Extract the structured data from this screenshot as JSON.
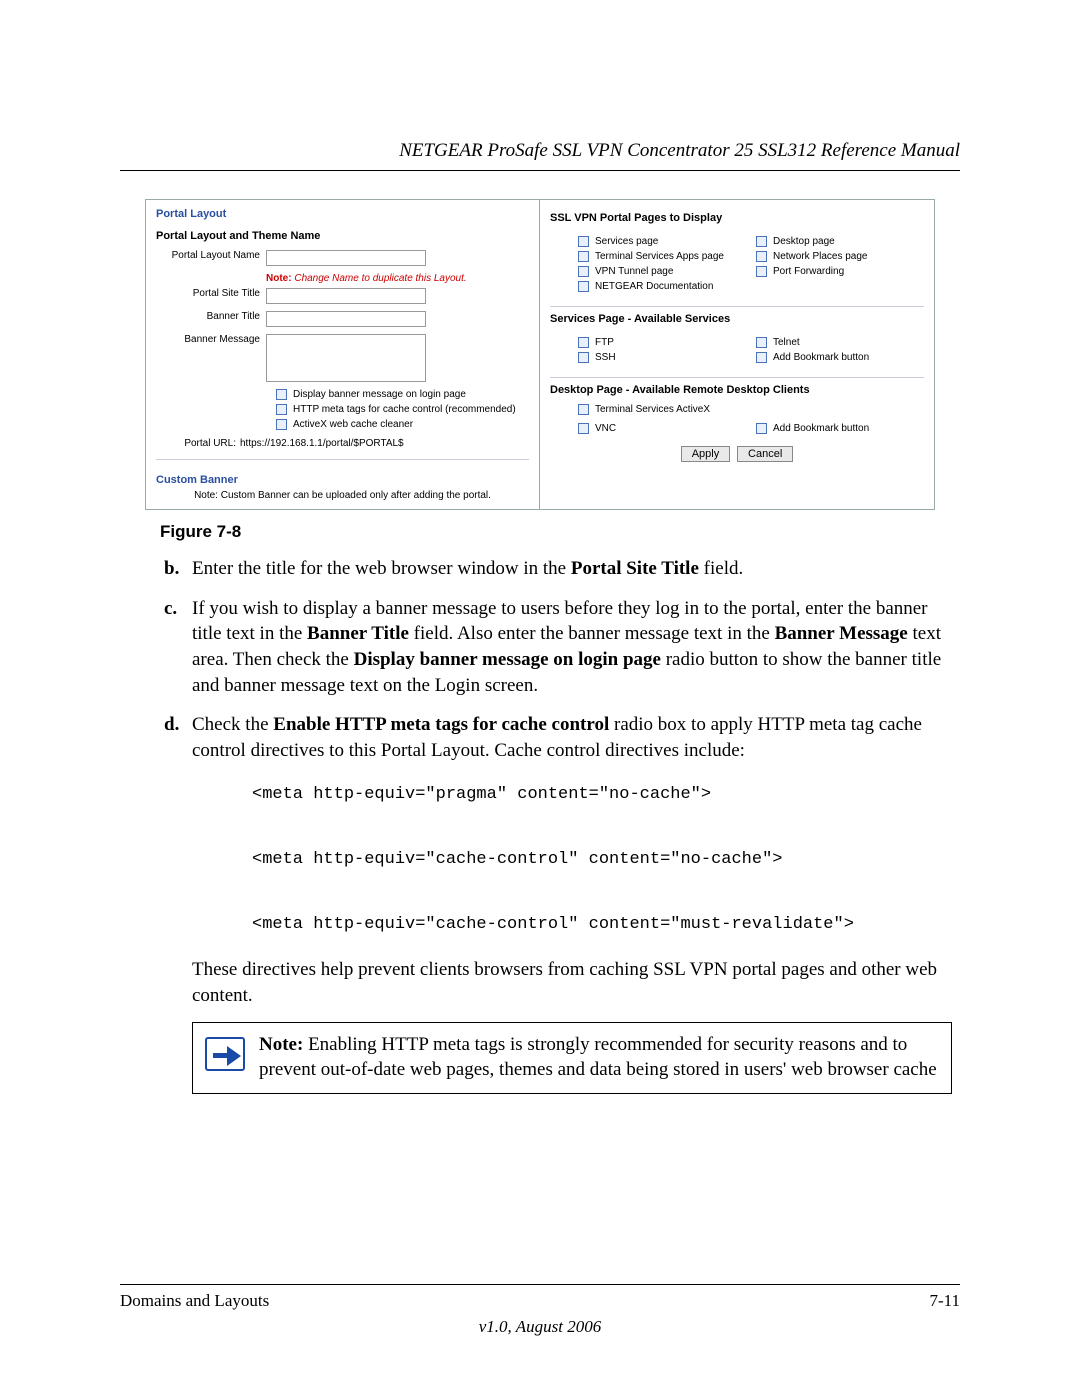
{
  "header": {
    "title": "NETGEAR ProSafe SSL VPN Concentrator 25 SSL312 Reference Manual"
  },
  "figure": {
    "caption": "Figure 7-8",
    "left": {
      "panel_title": "Portal Layout",
      "section_title": "Portal Layout and Theme Name",
      "labels": {
        "layout_name": "Portal Layout Name",
        "site_title": "Portal Site Title",
        "banner_title": "Banner Title",
        "banner_message": "Banner Message"
      },
      "note_prefix": "Note:",
      "note_text": " Change Name to duplicate this Layout.",
      "cb1": "Display banner message on login page",
      "cb2": "HTTP meta tags for cache control (recommended)",
      "cb3": "ActiveX web cache cleaner",
      "url_label": "Portal URL:",
      "url_value": "https://192.168.1.1/portal/$PORTAL$",
      "custom_banner_head": "Custom Banner",
      "custom_banner_note": "Note: Custom Banner can be uploaded only after adding the portal."
    },
    "right": {
      "section1": "SSL VPN Portal Pages to Display",
      "pages_left": [
        "Services page",
        "Terminal Services Apps page",
        "VPN Tunnel page",
        "NETGEAR Documentation"
      ],
      "pages_right": [
        "Desktop page",
        "Network Places page",
        "Port Forwarding"
      ],
      "section2": "Services Page - Available Services",
      "svc_left": [
        "FTP",
        "SSH"
      ],
      "svc_right": [
        "Telnet",
        "Add Bookmark button"
      ],
      "section3": "Desktop Page - Available Remote Desktop Clients",
      "dsk_full": [
        "Terminal Services ActiveX"
      ],
      "dsk_left": [
        "VNC"
      ],
      "dsk_right": [
        "Add Bookmark button"
      ],
      "btn_apply": "Apply",
      "btn_cancel": "Cancel"
    }
  },
  "items": {
    "b": {
      "mk": "b.",
      "pre": "Enter the title for the web browser window in the ",
      "b1": "Portal Site Title",
      "post": " field."
    },
    "c": {
      "mk": "c.",
      "t1": "If you wish to display a banner message to users before they log in to the portal, enter the banner title text in the ",
      "b1": "Banner Title",
      "t2": " field. Also enter the banner message text in the ",
      "b2": "Banner Message",
      "t3": " text area. Then check the ",
      "b3": "Display banner message on login page",
      "t4": " radio button to show the banner title and banner message text on the Login screen."
    },
    "d": {
      "mk": "d.",
      "t1": "Check the ",
      "b1": "Enable HTTP meta tags for cache control",
      "t2": " radio box to apply HTTP meta tag cache control directives to this Portal Layout. Cache control directives include:",
      "code": "<meta http-equiv=\"pragma\" content=\"no-cache\">\n\n<meta http-equiv=\"cache-control\" content=\"no-cache\">\n\n<meta http-equiv=\"cache-control\" content=\"must-revalidate\">",
      "t3": "These directives help prevent clients browsers from caching SSL VPN portal pages and other web content."
    }
  },
  "note": {
    "lead": "Note:",
    "body": " Enabling HTTP meta tags is strongly recommended for security reasons and to prevent out-of-date web pages, themes and data being stored in users' web browser cache"
  },
  "footer": {
    "left": "Domains and Layouts",
    "right": "7-11",
    "version": "v1.0, August 2006"
  }
}
